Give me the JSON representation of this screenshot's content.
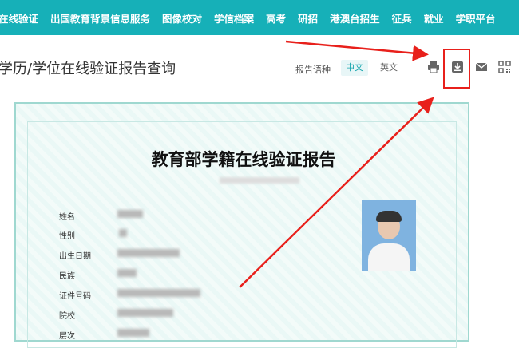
{
  "nav": {
    "items": [
      "在线验证",
      "出国教育背景信息服务",
      "图像校对",
      "学信档案",
      "高考",
      "研招",
      "港澳台招生",
      "征兵",
      "就业",
      "学职平台"
    ]
  },
  "page": {
    "title": "学历/学位在线验证报告查询",
    "lang_label": "报告语种",
    "lang_zh": "中文",
    "lang_en": "英文"
  },
  "toolbar": {
    "icons": [
      "print-icon",
      "download-icon",
      "mail-icon",
      "qrcode-icon"
    ]
  },
  "certificate": {
    "title": "教育部学籍在线验证报告",
    "fields": [
      "姓名",
      "性别",
      "出生日期",
      "民族",
      "证件号码",
      "院校",
      "层次"
    ]
  },
  "colors": {
    "brand": "#16b0b8",
    "annotation_red": "#e8201b"
  }
}
